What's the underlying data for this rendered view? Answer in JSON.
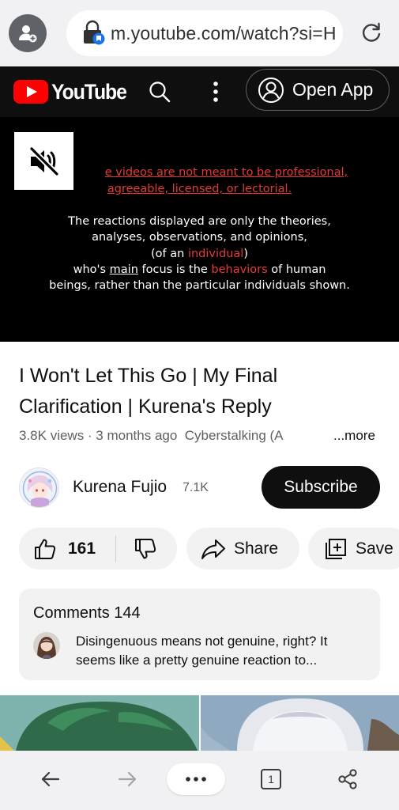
{
  "browser": {
    "url": "m.youtube.com/watch?si=H",
    "tab_count": "1"
  },
  "header": {
    "logo_text": "YouTube",
    "open_app_label": "Open App"
  },
  "player": {
    "line1": "e videos are not meant to be professional,",
    "line2": "agreeable, licensed, or lectorial.",
    "line3": "The reactions displayed are only the theories,",
    "line4": "analyses, observations, and opinions,",
    "line5_a": "(of an ",
    "line5_b": "individual",
    "line5_c": ")",
    "line6_a": "who's ",
    "line6_b": "main",
    "line6_c": " focus is the ",
    "line6_d": "behaviors",
    "line6_e": " of human",
    "line7": "beings, rather than the particular individuals shown."
  },
  "video": {
    "title": "I Won't Let This Go | My Final Clarification | Kurena's Reply",
    "views": "3.8K views · 3 months ago",
    "tags": "Cyberstalking (A",
    "more_label": "...more"
  },
  "channel": {
    "name": "Kurena Fujio",
    "subscribers": "7.1K",
    "subscribe_label": "Subscribe"
  },
  "actions": {
    "like_count": "161",
    "share_label": "Share",
    "save_label": "Save"
  },
  "comments": {
    "header": "Comments 144",
    "top_comment": "Disingenuous means not genuine, right? It seems like a pretty genuine reaction to..."
  },
  "colors": {
    "youtube_red": "#ff0000",
    "header_bg": "#0f0f0f",
    "browser_bg": "#f1f1f3",
    "pill_bg": "#f2f2f2",
    "accent_text_red": "#e53935"
  },
  "icons": {
    "profile": "profile-add-icon",
    "lock": "lock-icon",
    "reload": "reload-icon",
    "search": "search-icon",
    "more": "more-vertical-icon",
    "account": "account-circle-icon",
    "mute": "mute-icon",
    "like": "thumbs-up-icon",
    "dislike": "thumbs-down-icon",
    "share": "share-arrow-icon",
    "save": "save-playlist-icon",
    "back": "back-arrow-icon",
    "forward": "forward-arrow-icon",
    "menu": "menu-dots-icon",
    "tabs": "tabs-icon",
    "browser_share": "browser-share-icon"
  }
}
